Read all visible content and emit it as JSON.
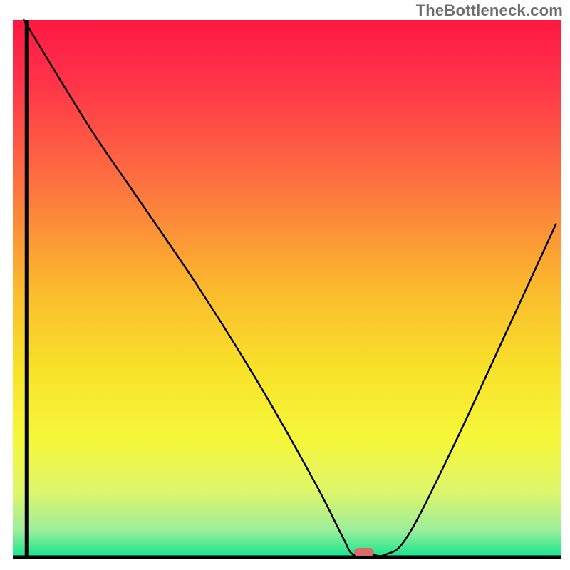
{
  "watermark": "TheBottleneck.com",
  "chart_data": {
    "type": "line",
    "title": "",
    "xlabel": "",
    "ylabel": "",
    "xlim": [
      0,
      100
    ],
    "ylim": [
      0,
      100
    ],
    "grid": false,
    "legend": false,
    "series": [
      {
        "name": "bottleneck-curve",
        "x": [
          2,
          14,
          22,
          34,
          45,
          55,
          60,
          62,
          65,
          68,
          72,
          80,
          90,
          99
        ],
        "values": [
          100,
          80,
          68,
          50,
          32,
          14,
          4,
          0.5,
          0.5,
          0.5,
          4,
          20,
          42,
          62
        ],
        "color": "#000000",
        "stroke_width": 2.5
      }
    ],
    "marker": {
      "x": 64,
      "y": 0,
      "color": "#d86a6a",
      "shape": "pill"
    },
    "background_gradient": {
      "type": "vertical",
      "stops": [
        {
          "offset": 0.0,
          "color": "#ff1744"
        },
        {
          "offset": 0.12,
          "color": "#ff3549"
        },
        {
          "offset": 0.3,
          "color": "#fd7040"
        },
        {
          "offset": 0.5,
          "color": "#fbba2d"
        },
        {
          "offset": 0.65,
          "color": "#f8e22a"
        },
        {
          "offset": 0.78,
          "color": "#f6f73a"
        },
        {
          "offset": 0.88,
          "color": "#ddf66c"
        },
        {
          "offset": 0.95,
          "color": "#9cee9c"
        },
        {
          "offset": 1.0,
          "color": "#13e58e"
        }
      ]
    },
    "axis_lines": {
      "left": {
        "x": 2.5,
        "from_y": 0,
        "to_y": 100,
        "color": "#000000",
        "width": 5
      },
      "bottom": {
        "y": 0,
        "from_x": 0,
        "to_x": 100,
        "color": "#000000",
        "width": 5
      }
    }
  }
}
